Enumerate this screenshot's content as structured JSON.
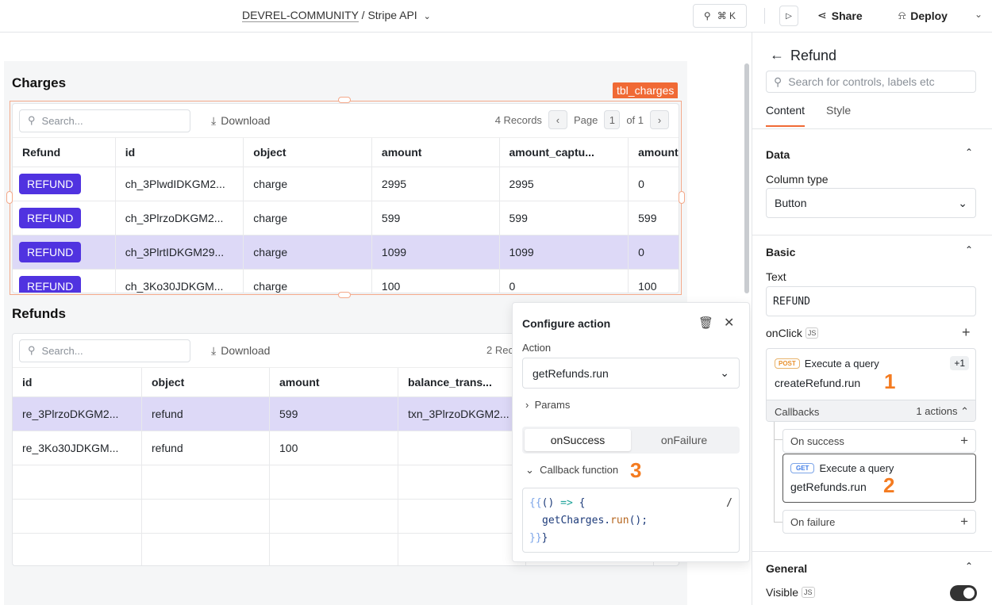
{
  "topbar": {
    "org": "DEVREL-COMMUNITY",
    "separator": "/",
    "app": "Stripe API",
    "shortcut": "⌘ K",
    "share": "Share",
    "deploy": "Deploy"
  },
  "charges": {
    "title": "Charges",
    "widget_name": "tbl_charges",
    "search_placeholder": "Search...",
    "download": "Download",
    "records": "4 Records",
    "page_label": "Page",
    "page": "1",
    "of": "of 1",
    "columns": [
      "Refund",
      "id",
      "object",
      "amount",
      "amount_captu...",
      "amount"
    ],
    "rows": [
      {
        "button": "REFUND",
        "id": "ch_3PlwdIDKGM2...",
        "object": "charge",
        "amount": "2995",
        "amount_captured": "2995",
        "amount_refunded": "0"
      },
      {
        "button": "REFUND",
        "id": "ch_3PlrzoDKGM2...",
        "object": "charge",
        "amount": "599",
        "amount_captured": "599",
        "amount_refunded": "599"
      },
      {
        "button": "REFUND",
        "id": "ch_3PlrtIDKGM29...",
        "object": "charge",
        "amount": "1099",
        "amount_captured": "1099",
        "amount_refunded": "0",
        "selected": true
      },
      {
        "button": "REFUND",
        "id": "ch_3Ko30JDKGM...",
        "object": "charge",
        "amount": "100",
        "amount_captured": "0",
        "amount_refunded": "100"
      }
    ]
  },
  "refunds": {
    "title": "Refunds",
    "search_placeholder": "Search...",
    "download": "Download",
    "records": "2 Rec",
    "columns": [
      "id",
      "object",
      "amount",
      "balance_trans..."
    ],
    "rows": [
      {
        "id": "re_3PlrzoDKGM2...",
        "object": "refund",
        "amount": "599",
        "balance": "txn_3PlrzoDKGM2...",
        "selected": true
      },
      {
        "id": "re_3Ko30JDKGM...",
        "object": "refund",
        "amount": "100",
        "balance": ""
      }
    ]
  },
  "popup": {
    "title": "Configure action",
    "action_label": "Action",
    "action_value": "getRefunds.run",
    "params": "Params",
    "tabs": [
      "onSuccess",
      "onFailure"
    ],
    "active_tab": "onSuccess",
    "callback_label": "Callback function",
    "step": "3",
    "code": {
      "l1a": "{{",
      "l1b": "() ",
      "l1c": "=>",
      "l1d": " {",
      "l2a": "getCharges",
      "l2b": ".",
      "l2c": "run",
      "l2d": "();",
      "l3a": "}}",
      "l3b": "}",
      "slash": "/"
    }
  },
  "panel": {
    "title": "Refund",
    "search_placeholder": "Search for controls, labels etc",
    "tabs": [
      "Content",
      "Style"
    ],
    "active_tab": "Content",
    "data": {
      "heading": "Data",
      "column_type_label": "Column type",
      "column_type": "Button"
    },
    "basic": {
      "heading": "Basic",
      "text_label": "Text",
      "text_value": "REFUND",
      "onclick_label": "onClick",
      "js": "JS",
      "action": {
        "method": "POST",
        "label": "Execute a query",
        "query": "createRefund.run",
        "extra": "+1",
        "step": "1"
      },
      "callbacks": {
        "label": "Callbacks",
        "count": "1 actions",
        "on_success": "On success",
        "on_failure": "On failure",
        "success_action": {
          "method": "GET",
          "label": "Execute a query",
          "query": "getRefunds.run",
          "step": "2"
        }
      }
    },
    "general": {
      "heading": "General",
      "visible_label": "Visible",
      "js": "JS",
      "visible": true
    }
  },
  "colors": {
    "accent": "#5033e0",
    "selection": "#f06a35",
    "annotation": "#f47b20",
    "selected_row": "#ddd9f7"
  }
}
